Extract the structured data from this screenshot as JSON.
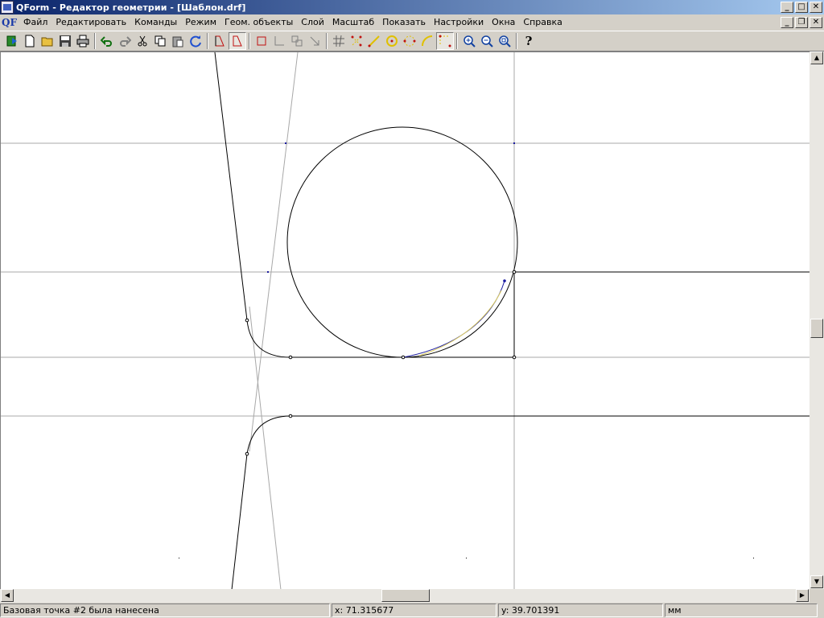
{
  "window": {
    "title": "QForm - Редактор геометрии - [Шаблон.drf]",
    "minimize": "_",
    "maximize": "□",
    "close": "✕",
    "restore": "❐"
  },
  "menubar": {
    "app_icon_text": "QF",
    "items": [
      "Файл",
      "Редактировать",
      "Команды",
      "Режим",
      "Геом. объекты",
      "Слой",
      "Масштаб",
      "Показать",
      "Настройки",
      "Окна",
      "Справка"
    ]
  },
  "toolbar": {
    "icons": [
      "exit-icon",
      "new-file-icon",
      "open-folder-icon",
      "save-icon",
      "print-icon",
      "undo-icon",
      "redo-icon",
      "cut-icon",
      "copy-icon",
      "paste-icon",
      "refresh-icon",
      "contour-icon",
      "contour-select-icon",
      "rectangle-icon",
      "angle-icon",
      "move-icon",
      "arrow-icon",
      "construction-lines-icon",
      "points-icon",
      "line-icon",
      "circle-icon",
      "circle-points-icon",
      "arc-icon",
      "corner-points-icon",
      "zoom-in-icon",
      "zoom-out-icon",
      "zoom-fit-icon",
      "help-icon"
    ],
    "help_glyph": "?"
  },
  "scrollbars": {
    "up": "▲",
    "down": "▼",
    "left": "◀",
    "right": "▶"
  },
  "status": {
    "message": "Базовая точка  #2 была нанесена",
    "x": "x: 71.315677",
    "y": "y: 39.701391",
    "unit": "мм"
  },
  "colors": {
    "title_gradient_start": "#0a246a",
    "title_gradient_end": "#a6caf0",
    "geometry": "#000000",
    "construction": "#a0a0a0",
    "spline": "#1a1aa0",
    "point": "#000080"
  }
}
